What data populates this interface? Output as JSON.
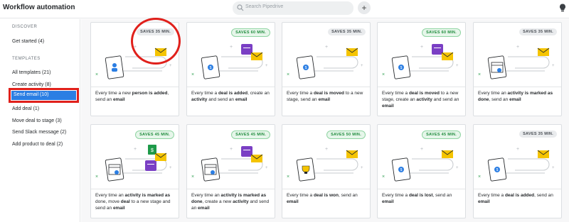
{
  "header": {
    "title": "Workflow automation",
    "search_placeholder": "Search Pipedrive",
    "add_label": "+"
  },
  "sidebar": {
    "discover_heading": "DISCOVER",
    "get_started": "Get started (4)",
    "templates_heading": "TEMPLATES",
    "items": [
      "All templates (21)",
      "Create activity (8)",
      "Send email (10)",
      "Add deal (1)",
      "Move deal to stage (3)",
      "Send Slack message (2)",
      "Add product to deal (2)"
    ]
  },
  "cards": [
    {
      "badge": "SAVES 35 MIN.",
      "badge_style": "gray",
      "icon": "person-document-icon",
      "text": [
        [
          "Every time a new ",
          ""
        ],
        [
          "person is added",
          "b"
        ],
        [
          ", send an ",
          ""
        ],
        [
          "email",
          "b"
        ]
      ]
    },
    {
      "badge": "SAVES 60 MIN.",
      "badge_style": "green",
      "icon": "deal-document-icon",
      "text": [
        [
          "Every time a ",
          ""
        ],
        [
          "deal is added",
          "b"
        ],
        [
          ", create an ",
          ""
        ],
        [
          "activity",
          "b"
        ],
        [
          " and send an ",
          ""
        ],
        [
          "email",
          "b"
        ]
      ]
    },
    {
      "badge": "SAVES 35 MIN.",
      "badge_style": "gray",
      "icon": "deal-document-icon",
      "text": [
        [
          "Every time a ",
          ""
        ],
        [
          "deal is moved",
          "b"
        ],
        [
          " to a new stage, send an ",
          ""
        ],
        [
          "email",
          "b"
        ]
      ]
    },
    {
      "badge": "SAVES 60 MIN.",
      "badge_style": "green",
      "icon": "deal-document-icon",
      "text": [
        [
          "Every time a ",
          ""
        ],
        [
          "deal is moved",
          "b"
        ],
        [
          " to a new stage, create an ",
          ""
        ],
        [
          "activity",
          "b"
        ],
        [
          " and send an ",
          ""
        ],
        [
          "email",
          "b"
        ]
      ]
    },
    {
      "badge": "SAVES 35 MIN.",
      "badge_style": "gray",
      "icon": "calendar-check-icon",
      "text": [
        [
          "Every time an ",
          ""
        ],
        [
          "activity is marked as done",
          "b"
        ],
        [
          ", send an ",
          ""
        ],
        [
          "email",
          "b"
        ]
      ]
    },
    {
      "badge": "SAVES 45 MIN.",
      "badge_style": "green",
      "icon": "calendar-check-icon",
      "text": [
        [
          "Every time an ",
          ""
        ],
        [
          "activity is marked as",
          "b"
        ],
        [
          " done, move ",
          ""
        ],
        [
          "deal",
          "b"
        ],
        [
          " to a new stage and send an ",
          ""
        ],
        [
          "email",
          "b"
        ]
      ]
    },
    {
      "badge": "SAVES 45 MIN.",
      "badge_style": "green",
      "icon": "calendar-check-icon",
      "text": [
        [
          "Every time an ",
          ""
        ],
        [
          "activity is marked as done",
          "b"
        ],
        [
          ", create a new ",
          ""
        ],
        [
          "activity",
          "b"
        ],
        [
          " and send an ",
          ""
        ],
        [
          "email",
          "b"
        ]
      ]
    },
    {
      "badge": "SAVES 50 MIN.",
      "badge_style": "green",
      "icon": "trophy-icon",
      "text": [
        [
          "Every time a ",
          ""
        ],
        [
          "deal is won",
          "b"
        ],
        [
          ", send an ",
          ""
        ],
        [
          "email",
          "b"
        ]
      ]
    },
    {
      "badge": "SAVES 45 MIN.",
      "badge_style": "green",
      "icon": "deal-lost-icon",
      "text": [
        [
          "Every time a ",
          ""
        ],
        [
          "deal is lost",
          "b"
        ],
        [
          ", send an ",
          ""
        ],
        [
          "email",
          "b"
        ]
      ]
    },
    {
      "badge": "SAVES 35 MIN.",
      "badge_style": "gray",
      "icon": "deal-document-icon",
      "text": [
        [
          "Every time a ",
          ""
        ],
        [
          "deal is added",
          "b"
        ],
        [
          ", send an ",
          ""
        ],
        [
          "email",
          "b"
        ]
      ]
    }
  ],
  "colors": {
    "accent_blue": "#2b7ee3",
    "highlight_red": "#e0201b",
    "envelope_yellow": "#f5c400",
    "calendar_purple": "#7a3fc4",
    "money_green": "#1e9a49"
  }
}
